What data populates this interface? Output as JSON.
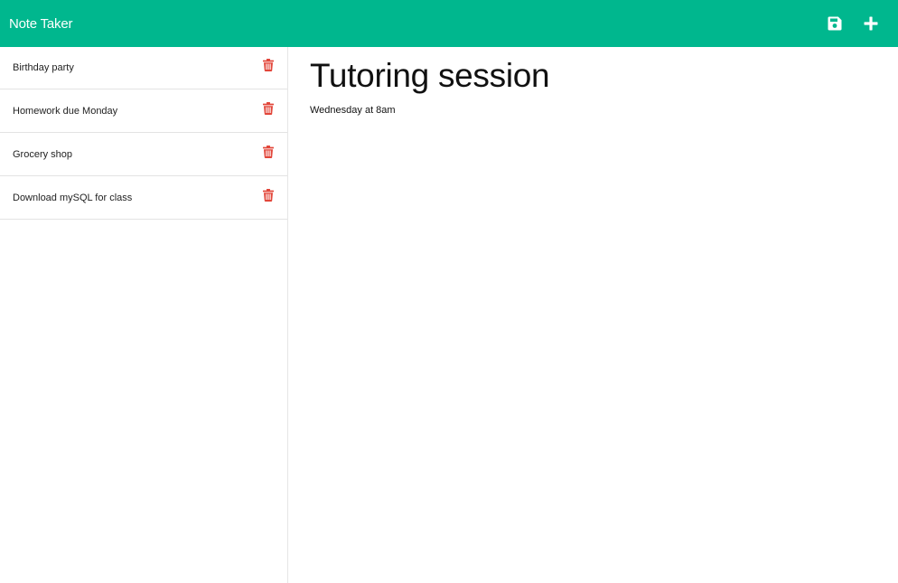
{
  "navbar": {
    "brand": "Note Taker",
    "save_icon": "save-icon",
    "add_icon": "plus-icon",
    "background_color": "#00b78e"
  },
  "sidebar": {
    "notes": [
      {
        "title": "Birthday party",
        "delete_icon": "trash-icon"
      },
      {
        "title": "Homework due Monday",
        "delete_icon": "trash-icon"
      },
      {
        "title": "Grocery shop",
        "delete_icon": "trash-icon"
      },
      {
        "title": "Download mySQL for class",
        "delete_icon": "trash-icon"
      }
    ],
    "delete_color": "#e2463a"
  },
  "editor": {
    "title": "Tutoring session",
    "body": "Wednesday at 8am"
  }
}
